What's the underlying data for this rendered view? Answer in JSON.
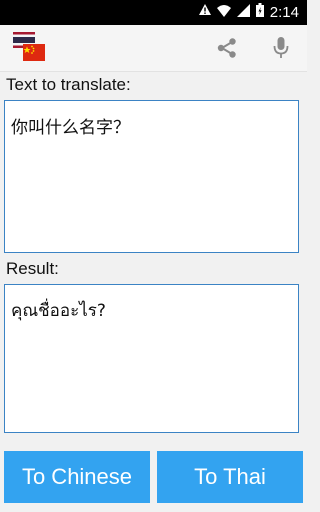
{
  "status_bar": {
    "time": "2:14"
  },
  "action_bar": {
    "logo_icon": "thai-chinese-flags-icon",
    "share_icon": "share-icon",
    "mic_icon": "microphone-icon"
  },
  "input": {
    "label": "Text to translate:",
    "value": "你叫什么名字？"
  },
  "result": {
    "label": "Result:",
    "value": "คุณชื่ออะไร?"
  },
  "buttons": {
    "to_chinese": "To Chinese",
    "to_thai": "To Thai"
  },
  "colors": {
    "accent": "#33a3f0",
    "border": "#3b83c4"
  }
}
